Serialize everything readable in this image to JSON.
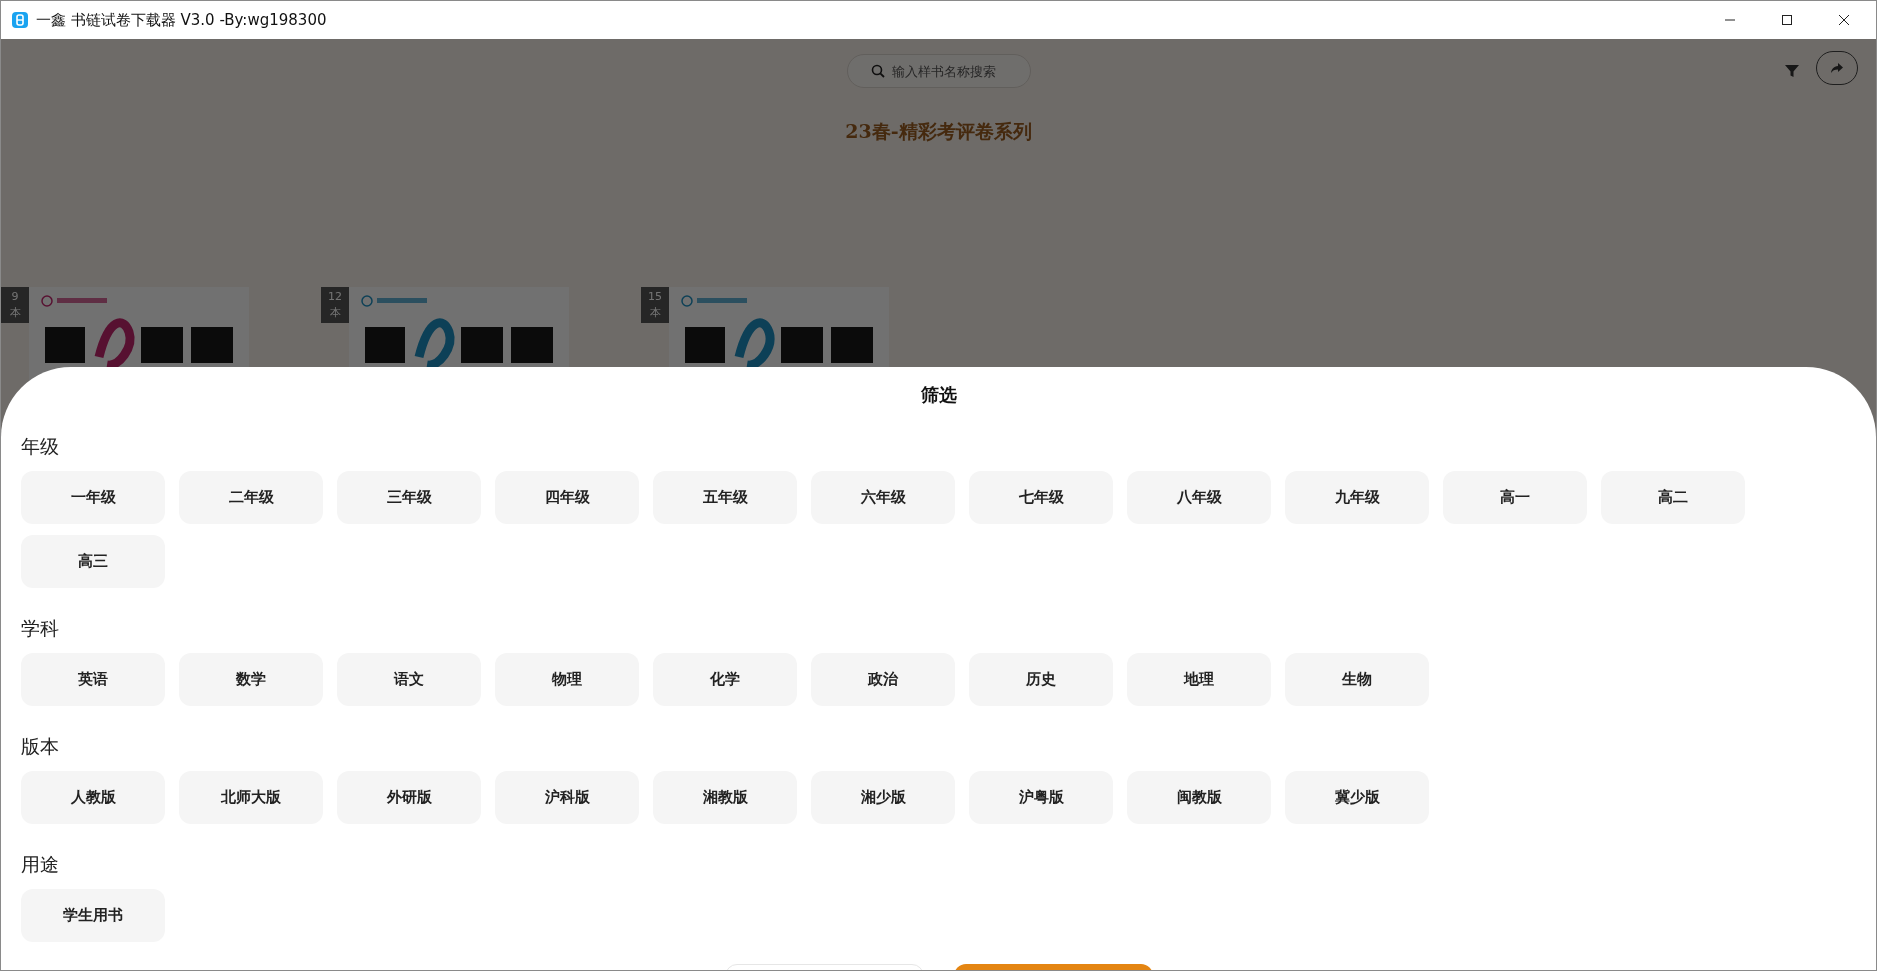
{
  "window": {
    "title": "一鑫 书链试卷下载器 V3.0 -By:wg198300"
  },
  "search": {
    "placeholder": "输入样书名称搜索"
  },
  "heading": "23春-精彩考评卷系列",
  "books": [
    {
      "count": "9",
      "unit": "本"
    },
    {
      "count": "12",
      "unit": "本"
    },
    {
      "count": "15",
      "unit": "本"
    }
  ],
  "filter": {
    "title": "筛选",
    "sections": [
      {
        "label": "年级",
        "options": [
          {
            "label": "一年级",
            "selected": false
          },
          {
            "label": "二年级",
            "selected": false
          },
          {
            "label": "三年级",
            "selected": false
          },
          {
            "label": "四年级",
            "selected": false
          },
          {
            "label": "五年级",
            "selected": false
          },
          {
            "label": "六年级",
            "selected": false
          },
          {
            "label": "七年级",
            "selected": false
          },
          {
            "label": "八年级",
            "selected": false
          },
          {
            "label": "九年级",
            "selected": false
          },
          {
            "label": "高一",
            "selected": false
          },
          {
            "label": "高二",
            "selected": false
          },
          {
            "label": "高三",
            "selected": false
          }
        ]
      },
      {
        "label": "学科",
        "options": [
          {
            "label": "英语",
            "selected": false
          },
          {
            "label": "数学",
            "selected": false
          },
          {
            "label": "语文",
            "selected": false
          },
          {
            "label": "物理",
            "selected": false
          },
          {
            "label": "化学",
            "selected": false
          },
          {
            "label": "政治",
            "selected": false
          },
          {
            "label": "历史",
            "selected": false
          },
          {
            "label": "地理",
            "selected": false
          },
          {
            "label": "生物",
            "selected": false
          }
        ]
      },
      {
        "label": "版本",
        "options": [
          {
            "label": "人教版",
            "selected": false
          },
          {
            "label": "北师大版",
            "selected": false
          },
          {
            "label": "外研版",
            "selected": false
          },
          {
            "label": "沪科版",
            "selected": false
          },
          {
            "label": "湘教版",
            "selected": false
          },
          {
            "label": "湘少版",
            "selected": false
          },
          {
            "label": "沪粤版",
            "selected": false
          },
          {
            "label": "闽教版",
            "selected": false
          },
          {
            "label": "冀少版",
            "selected": false
          }
        ]
      },
      {
        "label": "用途",
        "options": [
          {
            "label": "学生用书",
            "selected": false
          }
        ]
      }
    ],
    "buttons": [
      {
        "kind": "outline"
      },
      {
        "kind": "primary"
      }
    ]
  }
}
